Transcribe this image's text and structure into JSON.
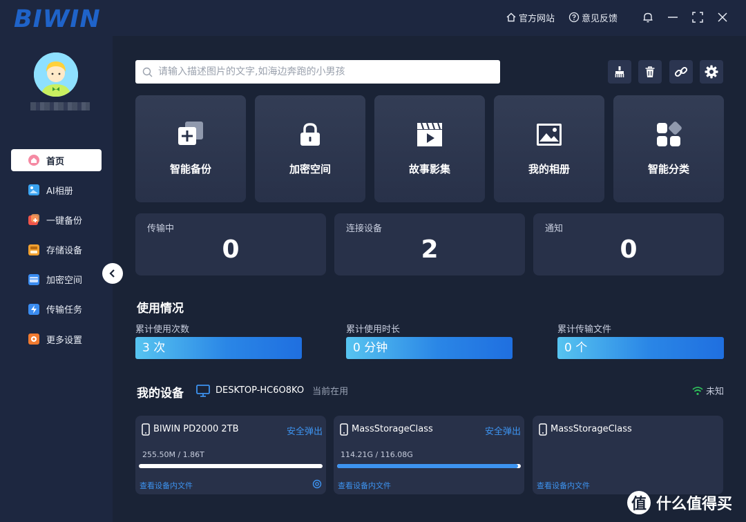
{
  "brand": {
    "logo": "BIWIN",
    "logo_color": "#1f63c9"
  },
  "titlebar": {
    "website_label": "官方网站",
    "feedback_label": "意见反馈",
    "icons": [
      "home-icon",
      "help-circle-icon",
      "bell-icon",
      "minimize-icon",
      "fullscreen-icon",
      "close-icon"
    ]
  },
  "sidebar": {
    "items": [
      {
        "label": "首页",
        "icon": "home-icon",
        "color": "#f06a8a",
        "active": true
      },
      {
        "label": "AI相册",
        "icon": "photo-icon",
        "color": "#3aa3f0"
      },
      {
        "label": "一键备份",
        "icon": "backup-icon",
        "color": "#f0554a"
      },
      {
        "label": "存储设备",
        "icon": "storage-icon",
        "color": "#f0a030"
      },
      {
        "label": "加密空间",
        "icon": "encrypted-icon",
        "color": "#3a8cf0"
      },
      {
        "label": "传输任务",
        "icon": "transfer-icon",
        "color": "#3a8cf0"
      },
      {
        "label": "更多设置",
        "icon": "settings-icon",
        "color": "#f07a30"
      }
    ]
  },
  "search": {
    "placeholder": "请输入描述图片的文字,如海边奔跑的小男孩"
  },
  "toolbar": {
    "icons": [
      "broom-icon",
      "trash-icon",
      "link-icon",
      "gear-icon"
    ]
  },
  "features": [
    {
      "label": "智能备份",
      "icon": "smart-backup-icon"
    },
    {
      "label": "加密空间",
      "icon": "lock-icon"
    },
    {
      "label": "故事影集",
      "icon": "clapperboard-icon"
    },
    {
      "label": "我的相册",
      "icon": "image-icon"
    },
    {
      "label": "智能分类",
      "icon": "category-icon"
    }
  ],
  "stats": [
    {
      "label": "传输中",
      "value": "0"
    },
    {
      "label": "连接设备",
      "value": "2"
    },
    {
      "label": "通知",
      "value": "0"
    }
  ],
  "usage": {
    "title": "使用情况",
    "items": [
      {
        "label": "累计使用次数",
        "value": "3 次"
      },
      {
        "label": "累计使用时长",
        "value": "0 分钟"
      },
      {
        "label": "累计传输文件",
        "value": "0 个"
      }
    ]
  },
  "devices": {
    "title": "我的设备",
    "pc_name": "DESKTOP-HC6O8KO",
    "pc_status": "当前在用",
    "wifi_status": "未知",
    "cards": [
      {
        "name": "BIWIN PD2000 2TB",
        "eject": "安全弹出",
        "capacity": "255.50M / 1.86T",
        "used_fraction": 0.0,
        "link": "查看设备内文件",
        "has_settings": true
      },
      {
        "name": "MassStorageClass",
        "eject": "安全弹出",
        "capacity": "114.21G / 116.08G",
        "used_fraction": 0.984,
        "link": "查看设备内文件",
        "has_settings": false
      },
      {
        "name": "MassStorageClass",
        "eject": "",
        "capacity": "",
        "used_fraction": null,
        "link": "查看设备内文件",
        "has_settings": false
      }
    ]
  },
  "watermark": {
    "text": "什么值得买",
    "badge": "值"
  }
}
